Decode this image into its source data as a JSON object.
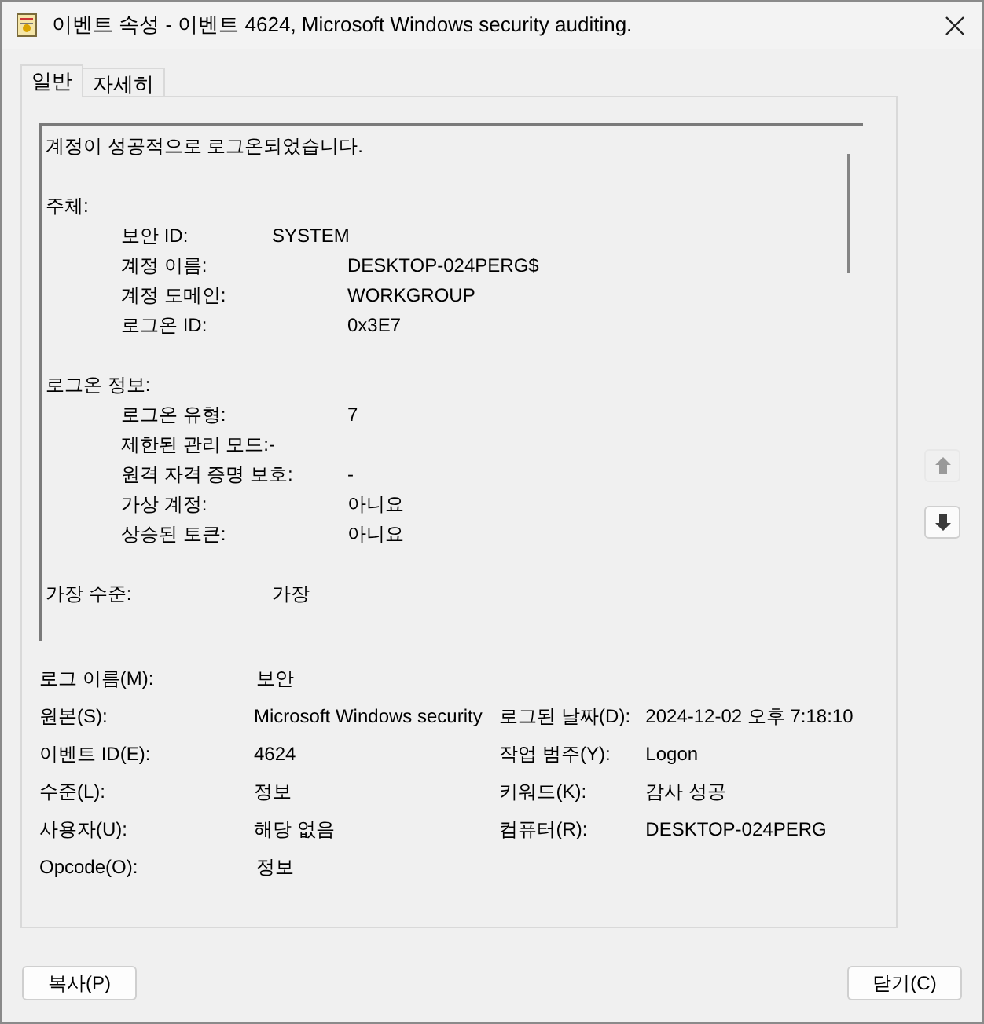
{
  "window": {
    "title": "이벤트 속성 - 이벤트 4624, Microsoft Windows security auditing."
  },
  "tabs": [
    {
      "label": "일반",
      "selected": true
    },
    {
      "label": "자세히",
      "selected": false
    }
  ],
  "description": "계정이 성공적으로 로그온되었습니다.\n\n주체:\n\t보안 ID:\t\tSYSTEM\n\t계정 이름:\t\tDESKTOP-024PERG$\n\t계정 도메인:\t\tWORKGROUP\n\t로그온 ID:\t\t0x3E7\n\n로그온 정보:\n\t로그온 유형:\t\t7\n\t제한된 관리 모드:-\n\t원격 자격 증명 보호:\t-\n\t가상 계정:\t\t아니요\n\t상승된 토큰:\t\t아니요\n\n가장 수준:\t\t가장",
  "nav": [
    {
      "kind": "up",
      "disabled": true
    },
    {
      "kind": "down",
      "disabled": false
    }
  ],
  "fields": [
    [
      {
        "label": "로그 이름(M):",
        "value": "보안"
      }
    ],
    [
      {
        "label": "원본(S):",
        "value": "Microsoft Windows security"
      },
      {
        "label": "로그된 날짜(D):",
        "value": "2024-12-02 오후 7:18:10"
      }
    ],
    [
      {
        "label": "이벤트 ID(E):",
        "value": "4624"
      },
      {
        "label": "작업 범주(Y):",
        "value": "Logon"
      }
    ],
    [
      {
        "label": "수준(L):",
        "value": "정보"
      },
      {
        "label": "키워드(K):",
        "value": "감사 성공"
      }
    ],
    [
      {
        "label": "사용자(U):",
        "value": "해당 없음"
      },
      {
        "label": "컴퓨터(R):",
        "value": "DESKTOP-024PERG"
      }
    ],
    [
      {
        "label": "Opcode(O):",
        "value": "정보"
      }
    ]
  ],
  "buttons": [
    {
      "label": "복사(P)"
    },
    {
      "label": "닫기(C)"
    }
  ]
}
